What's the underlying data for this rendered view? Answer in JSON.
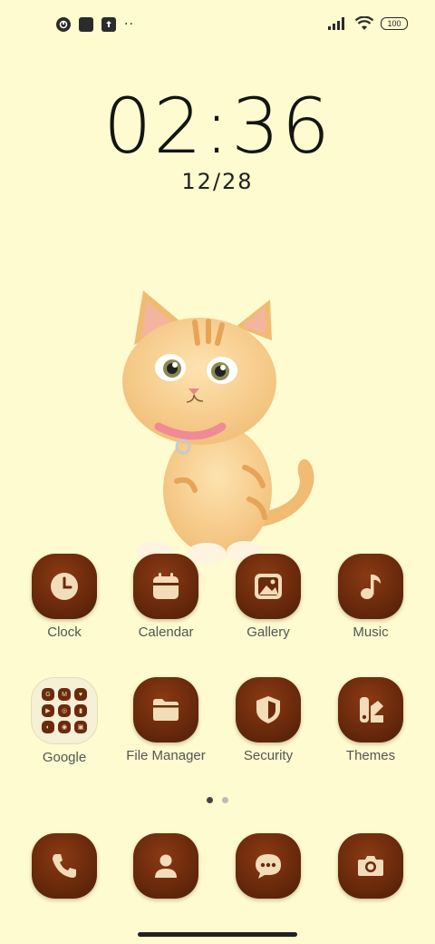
{
  "status_bar": {
    "battery": "100",
    "overflow": "··"
  },
  "lockscreen": {
    "time": "02:36",
    "date": "12/28"
  },
  "apps_row1": [
    {
      "label": "Clock",
      "icon": "clock-icon"
    },
    {
      "label": "Calendar",
      "icon": "calendar-icon"
    },
    {
      "label": "Gallery",
      "icon": "gallery-icon"
    },
    {
      "label": "Music",
      "icon": "music-icon"
    }
  ],
  "apps_row2": [
    {
      "label": "Google",
      "icon": "folder-icon",
      "folder_items": [
        "G",
        "M",
        "♥",
        "▶",
        "◎",
        "▮",
        "◐",
        "◉",
        "▣"
      ]
    },
    {
      "label": "File Manager",
      "icon": "folder-icon"
    },
    {
      "label": "Security",
      "icon": "shield-icon"
    },
    {
      "label": "Themes",
      "icon": "themes-icon"
    }
  ],
  "dock": [
    {
      "icon": "phone-icon"
    },
    {
      "icon": "contacts-icon"
    },
    {
      "icon": "messages-icon"
    },
    {
      "icon": "camera-icon"
    }
  ],
  "page_indicator": {
    "count": 2,
    "active": 1
  },
  "colors": {
    "background": "#fdfbcf",
    "icon_brown": "#6b2a0c",
    "icon_glyph": "#f3dcb8"
  }
}
